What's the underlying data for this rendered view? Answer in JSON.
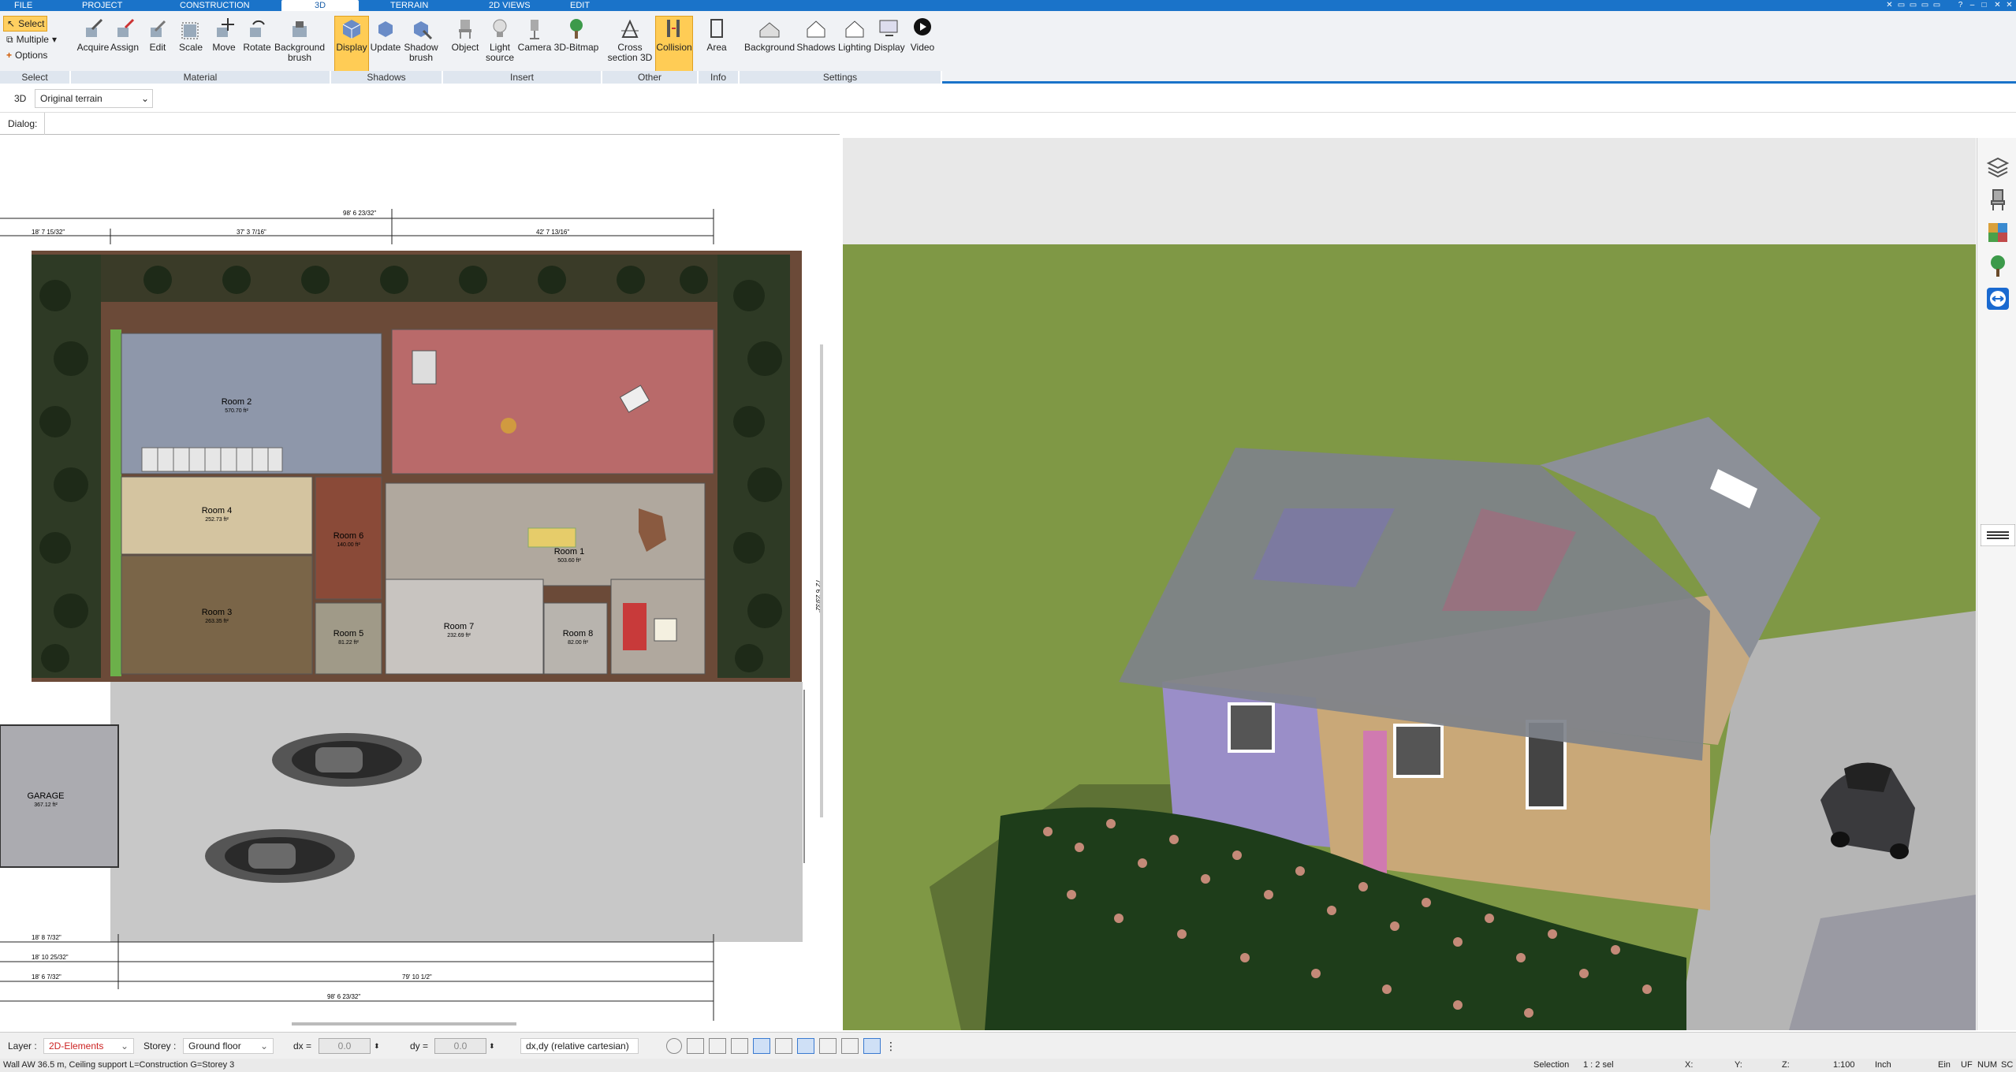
{
  "menu": {
    "tabs": [
      "FILE",
      "PROJECT",
      "CONSTRUCTION",
      "3D",
      "TERRAIN",
      "2D VIEWS",
      "EDIT"
    ],
    "active_tab": "3D"
  },
  "ribbon": {
    "select_group": {
      "select": "Select",
      "multiple": "Multiple",
      "options": "Options",
      "label": "Select"
    },
    "material": {
      "label": "Material",
      "buttons": [
        "Acquire",
        "Assign",
        "Edit",
        "Scale",
        "Move",
        "Rotate",
        "Background brush"
      ]
    },
    "shadows": {
      "label": "Shadows",
      "buttons": [
        "Display",
        "Update",
        "Shadow brush"
      ]
    },
    "insert": {
      "label": "Insert",
      "buttons": [
        "Object",
        "Light source",
        "Camera",
        "3D-Bitmap"
      ]
    },
    "other": {
      "label": "Other",
      "buttons": [
        "Cross section 3D",
        "Collision"
      ]
    },
    "info": {
      "label": "Info",
      "buttons": [
        "Area"
      ]
    },
    "settings": {
      "label": "Settings",
      "buttons": [
        "Background",
        "Shadows",
        "Lighting",
        "Display",
        "Video"
      ]
    }
  },
  "toolbar": {
    "mode": "3D",
    "terrain_select": "Original terrain"
  },
  "dialog": {
    "label": "Dialog:"
  },
  "plan": {
    "rooms": [
      {
        "name": "Room 2",
        "area": "570.70 ft²"
      },
      {
        "name": "Room 4",
        "area": "252.73 ft²"
      },
      {
        "name": "Room 6",
        "area": "140.00 ft²"
      },
      {
        "name": "Room 1",
        "area": "503.60 ft²"
      },
      {
        "name": "Room 3",
        "area": "263.35 ft²"
      },
      {
        "name": "Room 5",
        "area": "81.22 ft²"
      },
      {
        "name": "Room 7",
        "area": "232.69 ft²"
      },
      {
        "name": "Room 8",
        "area": "82.00 ft²"
      },
      {
        "name": "GARAGE",
        "area": "367.12 ft²"
      }
    ],
    "dims": {
      "top_total": "98' 6 23/32\"",
      "top_left": "37' 3 7/16\"",
      "top_right": "42' 7 13/16\"",
      "left_top": "18' 7 15/32\"",
      "bottom_total": "98' 6 23/32\"",
      "bottom_mid": "79' 10 1/2\"",
      "bottom_left1": "18' 8 7/32\"",
      "bottom_left2": "18' 10 25/32\"",
      "bottom_left3": "18' 6 7/32\"",
      "right_v": "72' 6 23/32\""
    }
  },
  "status": {
    "layer_label": "Layer :",
    "layer_value": "2D-Elements",
    "storey_label": "Storey :",
    "storey_value": "Ground floor",
    "dx_label": "dx =",
    "dx_value": "0.0",
    "dy_label": "dy =",
    "dy_value": "0.0",
    "coord_mode": "dx,dy (relative cartesian)"
  },
  "info": {
    "message": "Wall AW 36.5 m, Ceiling support L=Construction G=Storey 3",
    "selection": "Selection",
    "sel_value": "1 : 2 sel",
    "x": "X:",
    "y": "Y:",
    "z": "Z:",
    "scale": "1:100",
    "unit": "Inch",
    "ein": "Ein",
    "uf": "UF",
    "num": "NUM",
    "sc": "SC"
  },
  "colors": {
    "accent": "#1a73c9",
    "active_button": "#ffcc55",
    "layer_text": "#cc2222"
  }
}
